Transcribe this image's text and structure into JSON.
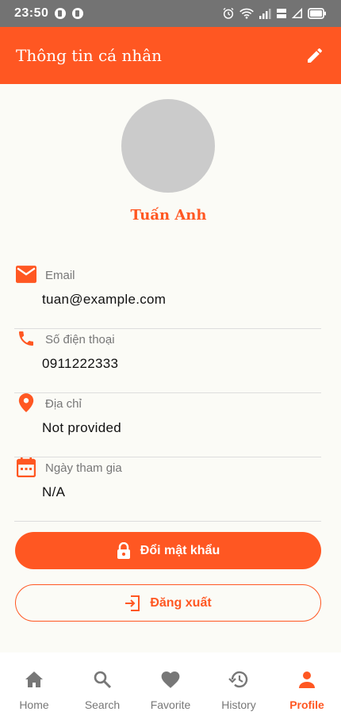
{
  "status_bar": {
    "time": "23:50"
  },
  "app_bar": {
    "title": "Thông tin cá nhân",
    "edit_icon": "pencil-icon"
  },
  "profile": {
    "name": "Tuấn Anh"
  },
  "info": [
    {
      "icon": "email-icon",
      "label": "Email",
      "value": "tuan@example.com"
    },
    {
      "icon": "phone-icon",
      "label": "Số điện thoại",
      "value": "0911222333"
    },
    {
      "icon": "location-pin-icon",
      "label": "Địa chỉ",
      "value": "Not provided"
    },
    {
      "icon": "calendar-icon",
      "label": "Ngày tham gia",
      "value": "N/A"
    }
  ],
  "buttons": {
    "change_password": "Đổi mật khẩu",
    "logout": "Đăng xuất"
  },
  "nav": [
    {
      "icon": "home-icon",
      "label": "Home"
    },
    {
      "icon": "search-icon",
      "label": "Search"
    },
    {
      "icon": "heart-icon",
      "label": "Favorite"
    },
    {
      "icon": "history-icon",
      "label": "History"
    },
    {
      "icon": "person-icon",
      "label": "Profile"
    }
  ],
  "colors": {
    "accent": "#ff5722",
    "status_bar": "#737373",
    "background": "#fbfbf6",
    "nav_inactive": "#777777"
  }
}
